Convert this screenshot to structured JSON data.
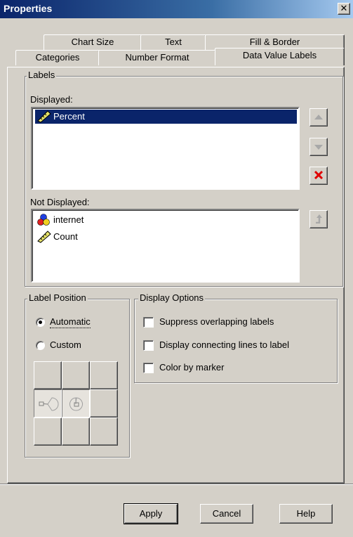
{
  "window": {
    "title": "Properties",
    "close_glyph": "✕"
  },
  "tabs": {
    "row_back": [
      "Chart Size",
      "Text",
      "Fill & Border"
    ],
    "row_front": [
      "Categories",
      "Number Format",
      "Data Value Labels"
    ],
    "active": "Data Value Labels"
  },
  "labels_group": {
    "title": "Labels",
    "displayed_label": "Displayed:",
    "displayed_items": [
      {
        "text": "Percent",
        "icon": "ruler-scale-icon",
        "selected": true
      }
    ],
    "not_displayed_label": "Not Displayed:",
    "not_displayed_items": [
      {
        "text": "internet",
        "icon": "category-circles-icon"
      },
      {
        "text": "Count",
        "icon": "ruler-scale-icon"
      }
    ],
    "buttons": {
      "move_up": "arrow-up-icon",
      "move_down": "arrow-down-icon",
      "remove": "red-x-icon",
      "add": "bent-up-arrow-icon"
    }
  },
  "label_position": {
    "title": "Label Position",
    "automatic": "Automatic",
    "custom": "Custom",
    "selected": "Automatic"
  },
  "display_options": {
    "title": "Display Options",
    "suppress": "Suppress overlapping labels",
    "connecting_lines": "Display connecting lines to label",
    "color_by_marker": "Color by marker"
  },
  "footer": {
    "apply": "Apply",
    "cancel": "Cancel",
    "help": "Help"
  },
  "colors": {
    "selection": "#0a246a",
    "title_bar": "#0a246a",
    "face": "#d4d0c8",
    "remove_red": "#e00000"
  }
}
